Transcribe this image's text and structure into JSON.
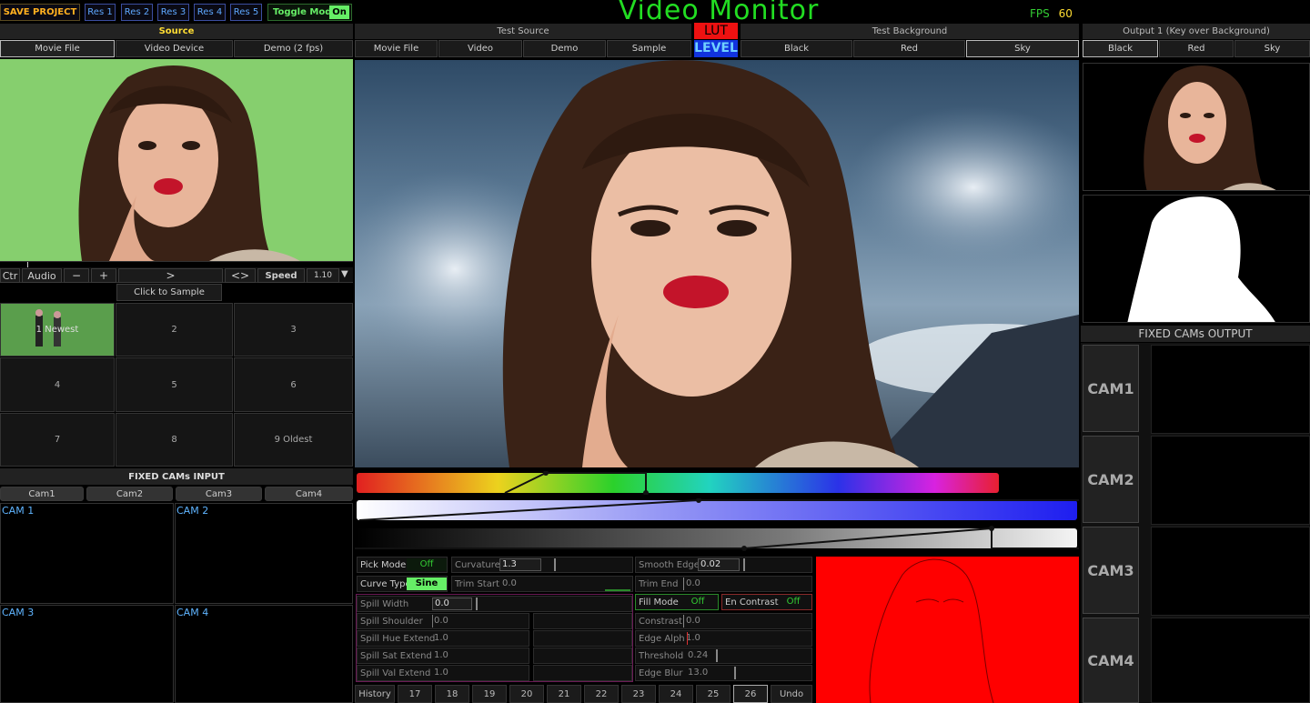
{
  "title": "Video Monitor",
  "fps_label": "FPS",
  "fps_value": "60",
  "top_bar": {
    "save_project": "SAVE PROJECT",
    "res_buttons": [
      "Res 1",
      "Res 2",
      "Res 3",
      "Res 4",
      "Res 5"
    ],
    "toggle_mode_label": "Toggle Mode",
    "toggle_mode_value": "On"
  },
  "source": {
    "header": "Source",
    "tabs": [
      "Movie File",
      "Video Device",
      "Demo (2 fps)"
    ],
    "controls": {
      "ctr": "Ctr",
      "audio": "Audio",
      "minus": "−",
      "plus": "+",
      "play": ">",
      "swap": "<>",
      "speed_label": "Speed",
      "speed_value": "1.10"
    },
    "click_to_sample": "Click to Sample",
    "sample_grid": [
      "1 Newest",
      "2",
      "3",
      "4",
      "5",
      "6",
      "7",
      "8",
      "9 Oldest"
    ]
  },
  "fixed_cams_input": {
    "header": "FIXED CAMs INPUT",
    "tabs": [
      "Cam1",
      "Cam2",
      "Cam3",
      "Cam4"
    ],
    "cams": [
      "CAM 1",
      "CAM 2",
      "CAM 3",
      "CAM 4"
    ]
  },
  "test_source": {
    "header": "Test Source",
    "tabs": [
      "Movie File",
      "Video",
      "Demo",
      "Sample"
    ]
  },
  "lut_label": "LUT",
  "level_label": "LEVEL",
  "test_background": {
    "header": "Test Background",
    "tabs": [
      "Black",
      "Red",
      "Sky"
    ]
  },
  "output": {
    "header": "Output 1 (Key over Background)",
    "tabs": [
      "Black",
      "Red",
      "Sky"
    ]
  },
  "fixed_cams_output": {
    "header": "FIXED CAMs OUTPUT",
    "cams": [
      "CAM1",
      "CAM2",
      "CAM3",
      "CAM4"
    ]
  },
  "params": {
    "pick_mode_label": "Pick Mode",
    "pick_mode_value": "Off",
    "curvature_label": "Curvature",
    "curvature_value": "1.3",
    "smooth_edge_label": "Smooth Edge",
    "smooth_edge_value": "0.02",
    "curve_type_label": "Curve Type",
    "curve_type_value": "Sine",
    "trim_start_label": "Trim Start",
    "trim_start_value": "0.0",
    "trim_end_label": "Trim End",
    "trim_end_value": "0.0",
    "spill_width_label": "Spill Width",
    "spill_width_value": "0.0",
    "fill_mode_label": "Fill Mode",
    "fill_mode_value": "Off",
    "en_contrast_label": "En Contrast",
    "en_contrast_value": "Off",
    "spill_shoulder_label": "Spill Shoulder",
    "spill_shoulder_value": "0.0",
    "contrast_label": "Constrast",
    "contrast_value": "0.0",
    "spill_hue_label": "Spill Hue Extend",
    "spill_hue_value": "1.0",
    "edge_alph_label": "Edge Alph",
    "edge_alph_value": "1.0",
    "spill_sat_label": "Spill Sat Extend",
    "spill_sat_value": "1.0",
    "threshold_label": "Threshold",
    "threshold_value": "0.24",
    "spill_val_label": "Spill Val Extend",
    "spill_val_value": "1.0",
    "edge_blur_label": "Edge Blur",
    "edge_blur_value": "13.0"
  },
  "history": {
    "label": "History",
    "items": [
      "17",
      "18",
      "19",
      "20",
      "21",
      "22",
      "23",
      "24",
      "25",
      "26"
    ],
    "selected": "26",
    "undo": "Undo"
  },
  "colors": {
    "title_green": "#22dd22",
    "fps_green": "#33cc33",
    "fps_value": "#ffdd33",
    "save_orange": "#ffb020",
    "res_blue": "#5fa8ff",
    "chroma_green": "#7ccf6a",
    "lut_red": "#ee1111",
    "level_blue": "#1133dd",
    "on_green": "#66ee66",
    "key_red": "#ff0000",
    "cam_text_blue": "#5fb4ff"
  }
}
